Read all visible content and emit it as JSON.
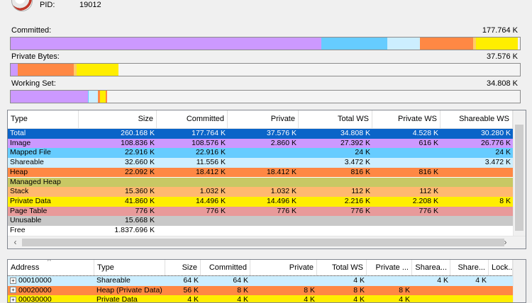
{
  "header": {
    "pid_label": "PID:",
    "pid_value": "19012"
  },
  "bars": [
    {
      "label": "Committed:",
      "value": "177.764 K",
      "segments": [
        {
          "color": "#cc99ff",
          "frac": 0.61
        },
        {
          "color": "#66ccff",
          "frac": 0.129
        },
        {
          "color": "#cceeff",
          "frac": 0.065
        },
        {
          "color": "#ff8844",
          "frac": 0.104
        },
        {
          "color": "#ffcc66",
          "frac": 0.006
        },
        {
          "color": "#ffee00",
          "frac": 0.082
        }
      ]
    },
    {
      "label": "Private Bytes:",
      "value": "37.576 K",
      "segments": [
        {
          "color": "#cc99ff",
          "frac": 0.014
        },
        {
          "color": "#ff8844",
          "frac": 0.11
        },
        {
          "color": "#ffcc66",
          "frac": 0.006
        },
        {
          "color": "#ffee00",
          "frac": 0.082
        }
      ]
    },
    {
      "label": "Working Set:",
      "value": "34.808 K",
      "segments": [
        {
          "color": "#cc99ff",
          "frac": 0.152
        },
        {
          "color": "#66ccff",
          "frac": 0.001
        },
        {
          "color": "#cceeff",
          "frac": 0.019
        },
        {
          "color": "#ff8844",
          "frac": 0.004
        },
        {
          "color": "#ffee00",
          "frac": 0.01
        },
        {
          "color": "#ff8844",
          "frac": 0.004
        }
      ]
    }
  ],
  "summary": {
    "columns": [
      "Type",
      "Size",
      "Committed",
      "Private",
      "Total WS",
      "Private WS",
      "Shareable WS"
    ],
    "rows": [
      {
        "bg": "#0a64c8",
        "fg": "#ffffff",
        "cells": [
          "Total",
          "260.168 K",
          "177.764 K",
          "37.576 K",
          "34.808 K",
          "4.528 K",
          "30.280 K"
        ]
      },
      {
        "bg": "#cc99ff",
        "fg": "#000000",
        "cells": [
          "Image",
          "108.836 K",
          "108.576 K",
          "2.860 K",
          "27.392 K",
          "616 K",
          "26.776 K"
        ]
      },
      {
        "bg": "#66ccff",
        "fg": "#000000",
        "cells": [
          "Mapped File",
          "22.916 K",
          "22.916 K",
          "",
          "24 K",
          "",
          "24 K"
        ]
      },
      {
        "bg": "#cceeff",
        "fg": "#000000",
        "cells": [
          "Shareable",
          "32.660 K",
          "11.556 K",
          "",
          "3.472 K",
          "",
          "3.472 K"
        ]
      },
      {
        "bg": "#ff8844",
        "fg": "#000000",
        "cells": [
          "Heap",
          "22.092 K",
          "18.412 K",
          "18.412 K",
          "816 K",
          "816 K",
          ""
        ]
      },
      {
        "bg": "#c8c864",
        "fg": "#000000",
        "cells": [
          "Managed Heap",
          "",
          "",
          "",
          "",
          "",
          ""
        ]
      },
      {
        "bg": "#ffb870",
        "fg": "#000000",
        "cells": [
          "Stack",
          "15.360 K",
          "1.032 K",
          "1.032 K",
          "112 K",
          "112 K",
          ""
        ]
      },
      {
        "bg": "#ffee00",
        "fg": "#000000",
        "cells": [
          "Private Data",
          "41.860 K",
          "14.496 K",
          "14.496 K",
          "2.216 K",
          "2.208 K",
          "8 K"
        ]
      },
      {
        "bg": "#e89a9a",
        "fg": "#000000",
        "cells": [
          "Page Table",
          "776 K",
          "776 K",
          "776 K",
          "776 K",
          "776 K",
          ""
        ]
      },
      {
        "bg": "#c8c8c8",
        "fg": "#000000",
        "cells": [
          "Unusable",
          "15.668 K",
          "",
          "",
          "",
          "",
          ""
        ]
      },
      {
        "bg": "#ffffff",
        "fg": "#000000",
        "cells": [
          "Free",
          "1.837.696 K",
          "",
          "",
          "",
          "",
          ""
        ]
      }
    ]
  },
  "details": {
    "columns": [
      "Address",
      "Type",
      "Size",
      "Committed",
      "Private",
      "Total WS",
      "Private ...",
      "Sharea...",
      "Share...",
      "Lock..."
    ],
    "rows": [
      {
        "bg": "#cceeff",
        "cells": [
          "00010000",
          "Shareable",
          "64 K",
          "64 K",
          "",
          "4 K",
          "",
          "4 K",
          "4 K",
          ""
        ]
      },
      {
        "bg": "#ff8844",
        "cells": [
          "00020000",
          "Heap (Private Data)",
          "56 K",
          "8 K",
          "8 K",
          "8 K",
          "8 K",
          "",
          "",
          ""
        ]
      },
      {
        "bg": "#ffee00",
        "cells": [
          "00030000",
          "Private Data",
          "4 K",
          "4 K",
          "4 K",
          "4 K",
          "4 K",
          "",
          "",
          ""
        ]
      }
    ]
  },
  "scroll": {
    "left_arrow": "‹",
    "right_arrow": "›",
    "sort_indicator": "^"
  }
}
